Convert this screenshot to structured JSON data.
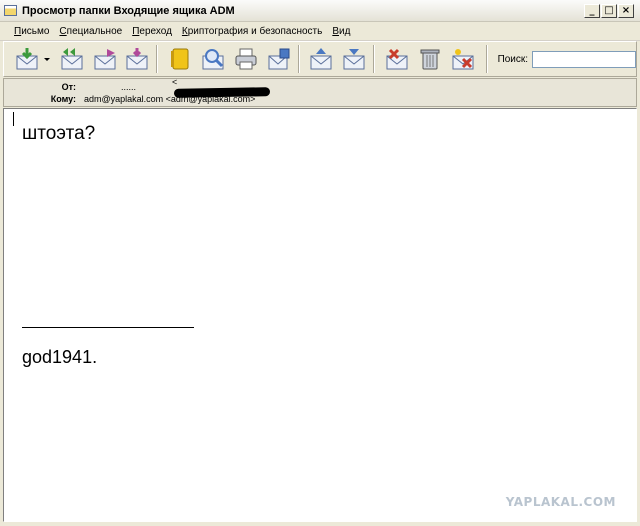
{
  "window": {
    "title": "Просмотр папки Входящие ящика ADM",
    "controls": [
      "_",
      "□",
      "×"
    ]
  },
  "menu": {
    "items": [
      {
        "accel": "П",
        "rest": "исьмо"
      },
      {
        "accel": "С",
        "rest": "пециальное"
      },
      {
        "accel": "П",
        "rest": "ереход"
      },
      {
        "accel": "К",
        "rest": "риптография и безопасность"
      },
      {
        "accel": "В",
        "rest": "ид"
      }
    ]
  },
  "toolbar": {
    "buttons": [
      "get-mail-icon",
      "reply-all-icon",
      "forward-icon",
      "redirect-icon",
      "address-book-icon",
      "search-icon",
      "print-icon",
      "save-icon",
      "previous-icon",
      "next-icon",
      "delete-icon",
      "trash-icon",
      "junk-icon"
    ],
    "search_label": "Поиск:",
    "search_value": ""
  },
  "header": {
    "from_label": "От:",
    "from_name": "......",
    "from_addr_prefix": "<",
    "to_label": "Кому:",
    "to_value": "adm@yaplakal.com <adm@yaplakal.com>"
  },
  "message": {
    "text": "штоэта?",
    "signature": "god1941."
  },
  "watermark": "YAPLAKAL.COM",
  "colors": {
    "chrome": "#ece9d8",
    "accent_green": "#3c9a3c",
    "accent_blue": "#4a78c2",
    "accent_red": "#c83c2c",
    "accent_yellow": "#f0c419"
  }
}
